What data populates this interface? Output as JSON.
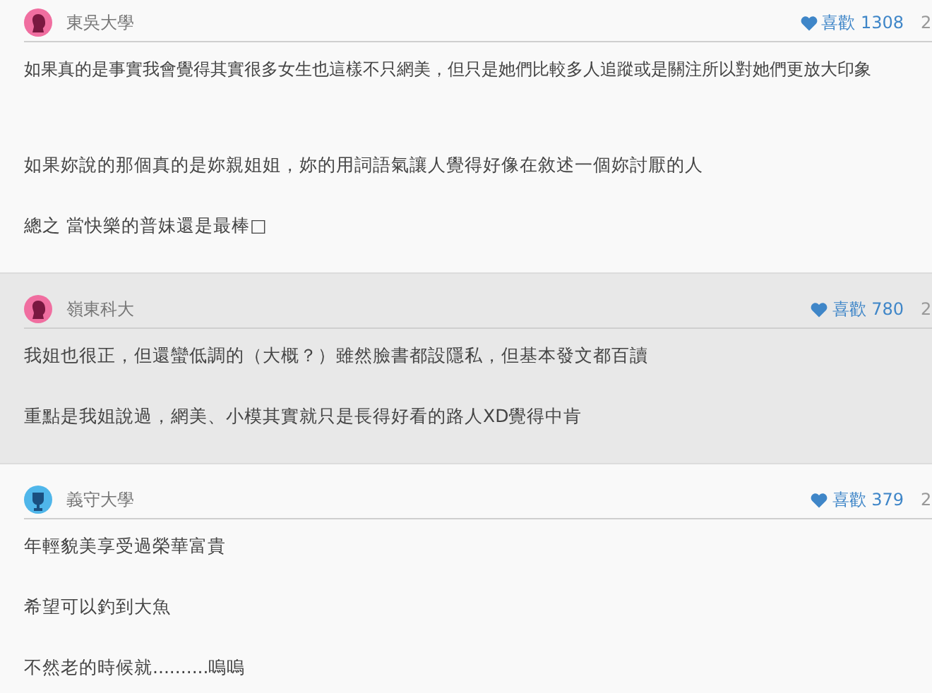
{
  "comments": [
    {
      "avatar": {
        "kind": "female"
      },
      "school": "東吳大學",
      "likes": "喜歡 1308",
      "time": "2",
      "selected": false,
      "paragraphs": [
        {
          "text": "如果真的是事實我會覺得其實很多女生也這樣不只網美，但只是她們比較多人追蹤或是關注所以對她們更放大印象"
        },
        {
          "text": "如果妳說的那個真的是妳親姐姐，妳的用詞語氣讓人覺得好像在敘述一個妳討厭的人"
        },
        {
          "text": "總之 當快樂的普妹還是最棒□"
        }
      ]
    },
    {
      "avatar": {
        "kind": "female"
      },
      "school": "嶺東科大",
      "likes": "喜歡 780",
      "time": "2",
      "selected": true,
      "paragraphs": [
        {
          "text": "我姐也很正，但還蠻低調的（大概？）雖然臉書都設隱私，但基本發文都百讀"
        },
        {
          "text": "重點是我姐說過，網美、小模其實就只是長得好看的路人XD覺得中肯"
        }
      ]
    },
    {
      "avatar": {
        "kind": "male"
      },
      "school": "義守大學",
      "likes": "喜歡 379",
      "time": "2",
      "selected": false,
      "paragraphs": [
        {
          "text": "年輕貌美享受過榮華富貴"
        },
        {
          "text": "希望可以釣到大魚"
        },
        {
          "text": "不然老的時候就..........嗚嗚"
        }
      ]
    }
  ]
}
